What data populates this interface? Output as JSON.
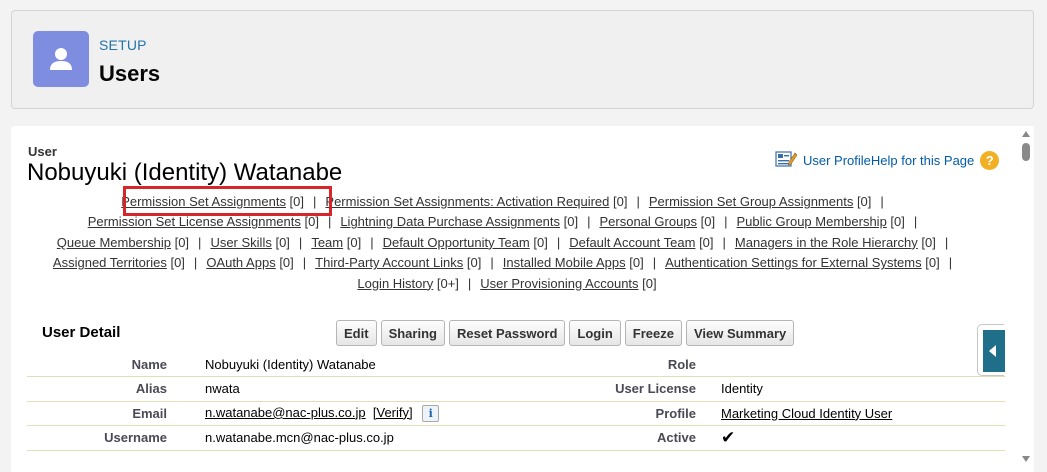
{
  "header": {
    "setup_label": "SETUP",
    "title": "Users",
    "icon": "user-icon",
    "icon_color": "#7f8de1"
  },
  "record": {
    "type_label": "User",
    "name": "Nobuyuki (Identity) Watanabe",
    "profile_link": "User Profile",
    "help_link": "Help for this Page",
    "help_icon": "question-circle-icon"
  },
  "related_links": [
    {
      "label": "Permission Set Assignments",
      "count": "[0]"
    },
    {
      "label": "Permission Set Assignments: Activation Required",
      "count": "[0]"
    },
    {
      "label": "Permission Set Group Assignments",
      "count": "[0]"
    },
    {
      "label": "Permission Set License Assignments",
      "count": "[0]"
    },
    {
      "label": "Lightning Data Purchase Assignments",
      "count": "[0]"
    },
    {
      "label": "Personal Groups",
      "count": "[0]"
    },
    {
      "label": "Public Group Membership",
      "count": "[0]"
    },
    {
      "label": "Queue Membership",
      "count": "[0]"
    },
    {
      "label": "User Skills",
      "count": "[0]"
    },
    {
      "label": "Team",
      "count": "[0]"
    },
    {
      "label": "Default Opportunity Team",
      "count": "[0]"
    },
    {
      "label": "Default Account Team",
      "count": "[0]"
    },
    {
      "label": "Managers in the Role Hierarchy",
      "count": "[0]"
    },
    {
      "label": "Assigned Territories",
      "count": "[0]"
    },
    {
      "label": "OAuth Apps",
      "count": "[0]"
    },
    {
      "label": "Third-Party Account Links",
      "count": "[0]"
    },
    {
      "label": "Installed Mobile Apps",
      "count": "[0]"
    },
    {
      "label": "Authentication Settings for External Systems",
      "count": "[0]"
    },
    {
      "label": "Login History",
      "count": "[0+]"
    },
    {
      "label": "User Provisioning Accounts",
      "count": "[0]"
    }
  ],
  "detail": {
    "title": "User Detail",
    "buttons": [
      "Edit",
      "Sharing",
      "Reset Password",
      "Login",
      "Freeze",
      "View Summary"
    ],
    "rows": [
      {
        "l1": "Name",
        "v1": "Nobuyuki (Identity) Watanabe",
        "l2": "Role",
        "v2": ""
      },
      {
        "l1": "Alias",
        "v1": "nwata",
        "l2": "User License",
        "v2": "Identity"
      },
      {
        "l1": "Email",
        "v1": "n.watanabe@nac-plus.co.jp",
        "v1_extra": "[Verify]",
        "l2": "Profile",
        "v2": "Marketing Cloud Identity User"
      },
      {
        "l1": "Username",
        "v1": "n.watanabe.mcn@nac-plus.co.jp",
        "l2": "Active",
        "v2": "✔"
      }
    ]
  },
  "colors": {
    "link": "#015ba7",
    "highlight": "#d6262c",
    "side_tab": "#1f6f8b"
  }
}
